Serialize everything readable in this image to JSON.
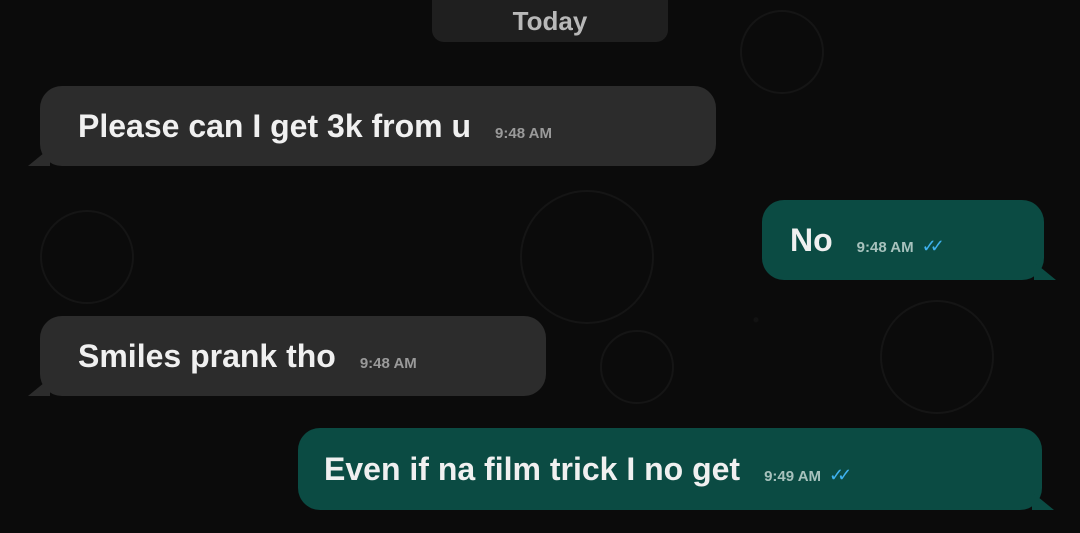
{
  "date_chip": "Today",
  "messages": [
    {
      "direction": "incoming",
      "text": "Please can I get 3k from u",
      "time": "9:48 AM"
    },
    {
      "direction": "outgoing",
      "text": "No",
      "time": "9:48 AM",
      "status_icon": "double-check-icon"
    },
    {
      "direction": "incoming",
      "text": "Smiles prank tho",
      "time": "9:48 AM"
    },
    {
      "direction": "outgoing",
      "text": "Even if na film trick I no get",
      "time": "9:49 AM",
      "status_icon": "double-check-icon"
    }
  ],
  "colors": {
    "background": "#0b0b0b",
    "incoming_bubble": "#2c2c2c",
    "outgoing_bubble": "#0b4b43",
    "read_ticks": "#3fb1ee"
  }
}
